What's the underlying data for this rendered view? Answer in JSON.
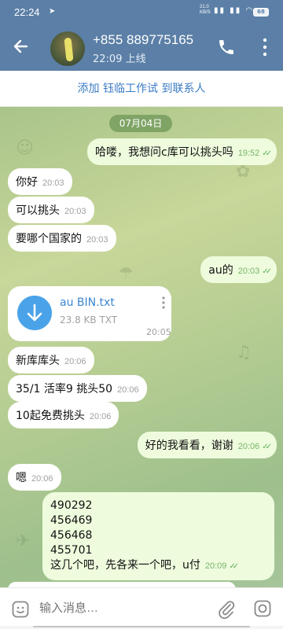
{
  "status_bar": {
    "time": "22:24",
    "net_speed": "21.0",
    "net_unit": "KB/S",
    "battery": "68"
  },
  "header": {
    "title": "+855 889775165",
    "subtitle": "22:09 上线"
  },
  "add_contact": {
    "label": "添加 钰临工作试 到联系人"
  },
  "chat": {
    "date": "07月04日",
    "messages": [
      {
        "dir": "out",
        "text": "哈喽，我想问c库可以挑头吗",
        "time": "19:52"
      },
      {
        "dir": "in",
        "text": "你好",
        "time": "20:03"
      },
      {
        "dir": "in",
        "text": "可以挑头",
        "time": "20:03"
      },
      {
        "dir": "in",
        "text": "要哪个国家的",
        "time": "20:03"
      },
      {
        "dir": "out",
        "text": "au的",
        "time": "20:03"
      },
      {
        "dir": "in",
        "text": "新库库头",
        "time": "20:06"
      },
      {
        "dir": "in",
        "text": "35/1 活率9  挑头50",
        "time": "20:06"
      },
      {
        "dir": "in",
        "text": "10起免费挑头",
        "time": "20:06"
      },
      {
        "dir": "out",
        "text": "好的我看看，谢谢",
        "time": "20:06"
      },
      {
        "dir": "in",
        "text": "嗯",
        "time": "20:06"
      }
    ],
    "file": {
      "name": "au  BIN.txt",
      "size": "23.8 KB TXT",
      "time": "20:05"
    },
    "multiline": {
      "lines": [
        "490292",
        "456469",
        "456468",
        "455701",
        "这几个吧，先各来一个吧，u付"
      ],
      "time": "20:09"
    }
  },
  "input": {
    "placeholder": "输入消息…"
  },
  "colors": {
    "header_bg": "#5b7fa6",
    "outgoing_bubble": "#eefcdd",
    "accent_link": "#3b7cc4",
    "file_icon": "#4aa3e8"
  }
}
